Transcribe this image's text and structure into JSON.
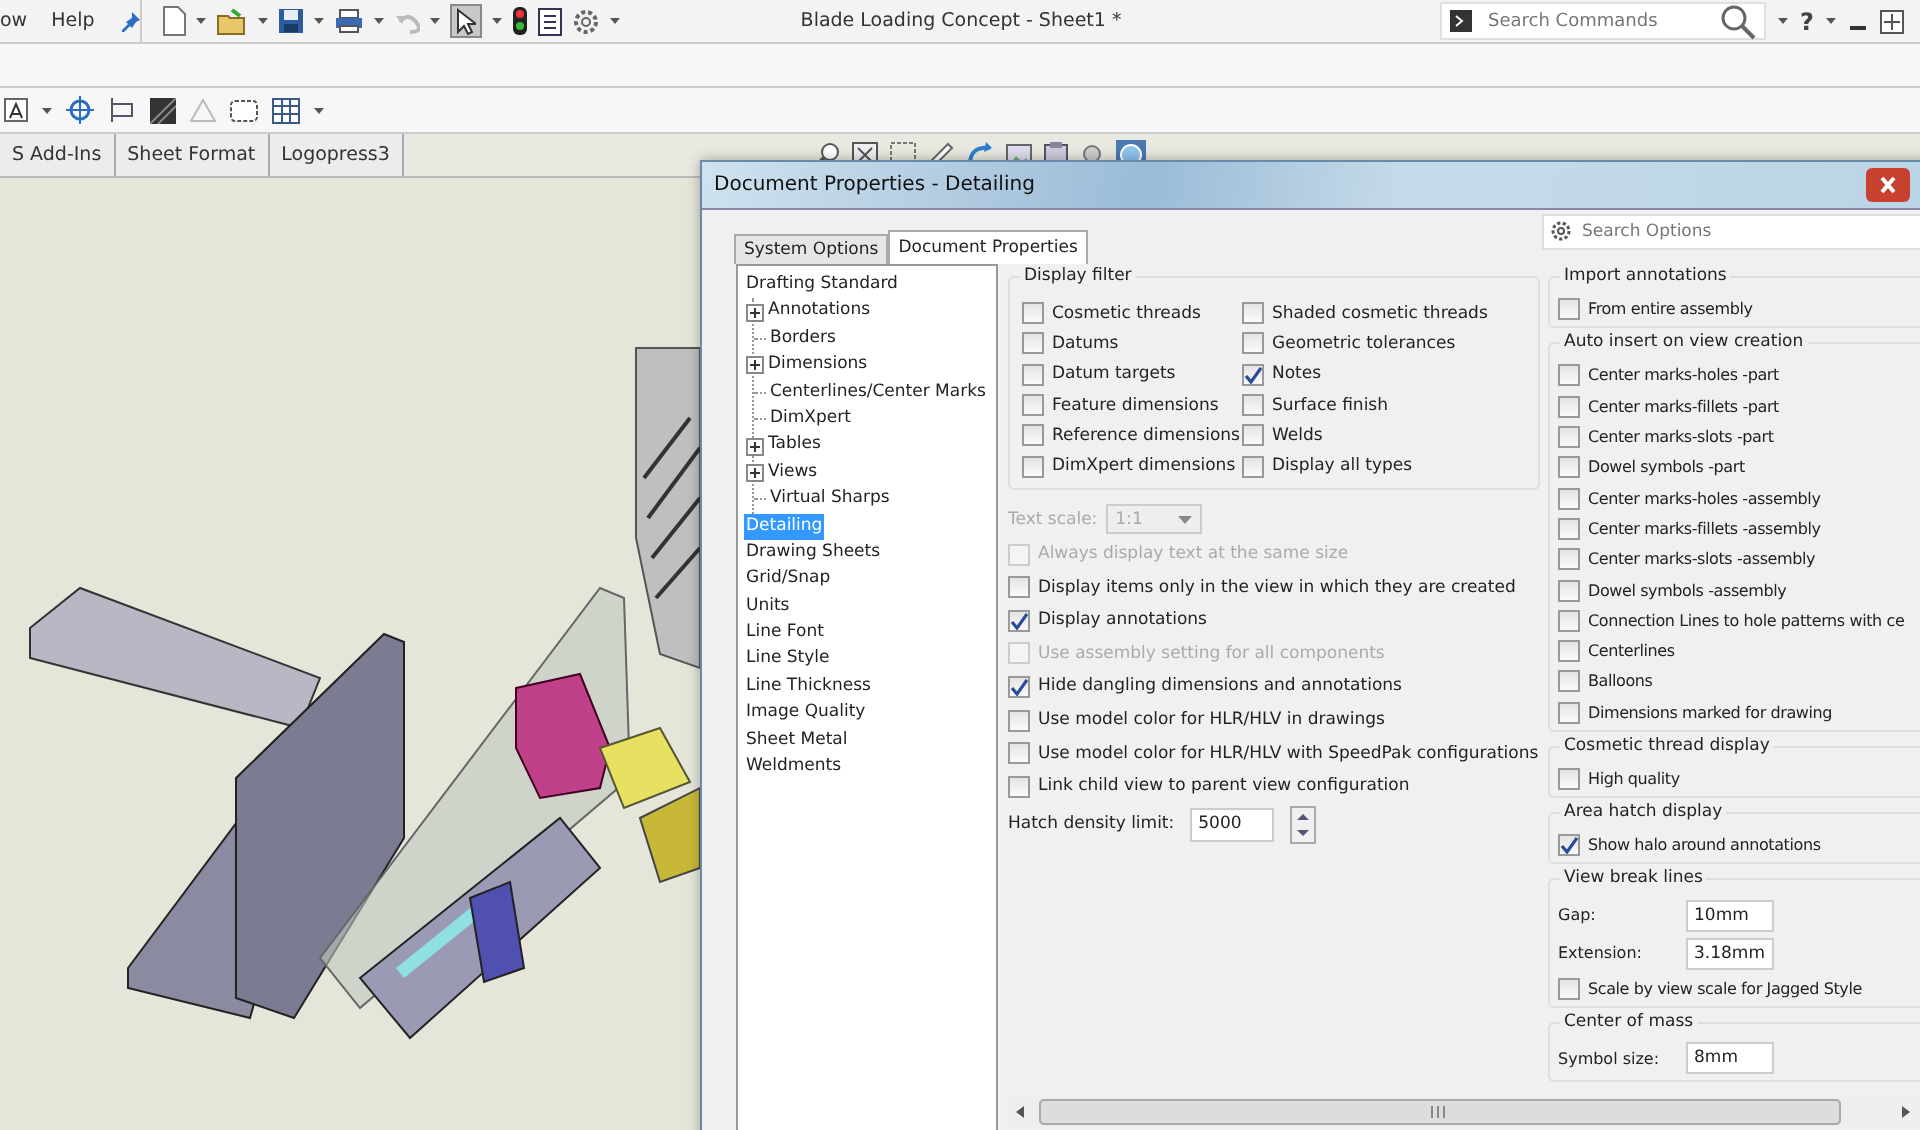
{
  "menu": [
    {
      "label": "ow"
    },
    {
      "label": "Help"
    }
  ],
  "window": {
    "title": "Blade Loading Concept - Sheet1 *"
  },
  "search_commands": {
    "placeholder": "Search Commands"
  },
  "help_button": {
    "label": "?"
  },
  "tabs": [
    {
      "label": "S Add-Ins",
      "selected": false
    },
    {
      "label": "Sheet Format",
      "selected": false
    },
    {
      "label": "Logopress3",
      "selected": false
    }
  ],
  "dialog": {
    "title": "Document Properties - Detailing",
    "tabs": [
      {
        "label": "System Options",
        "selected": false
      },
      {
        "label": "Document Properties",
        "selected": true
      }
    ],
    "search": {
      "placeholder": "Search Options"
    },
    "tree": [
      {
        "label": "Drafting Standard",
        "selected": false,
        "children": [
          {
            "label": "Annotations",
            "expandable": true,
            "selected": false
          },
          {
            "label": "Borders",
            "expandable": false,
            "selected": false
          },
          {
            "label": "Dimensions",
            "expandable": true,
            "selected": false
          },
          {
            "label": "Centerlines/Center Marks",
            "expandable": false,
            "selected": false
          },
          {
            "label": "DimXpert",
            "expandable": false,
            "selected": false
          },
          {
            "label": "Tables",
            "expandable": true,
            "selected": false
          },
          {
            "label": "Views",
            "expandable": true,
            "selected": false
          },
          {
            "label": "Virtual Sharps",
            "expandable": false,
            "selected": false
          }
        ]
      },
      {
        "label": "Detailing",
        "selected": true
      },
      {
        "label": "Drawing Sheets",
        "selected": false
      },
      {
        "label": "Grid/Snap",
        "selected": false
      },
      {
        "label": "Units",
        "selected": false
      },
      {
        "label": "Line Font",
        "selected": false
      },
      {
        "label": "Line Style",
        "selected": false
      },
      {
        "label": "Line Thickness",
        "selected": false
      },
      {
        "label": "Image Quality",
        "selected": false
      },
      {
        "label": "Sheet Metal",
        "selected": false
      },
      {
        "label": "Weldments",
        "selected": false
      }
    ],
    "display_filter": {
      "title": "Display filter",
      "items": [
        {
          "label": "Cosmetic threads",
          "checked": false
        },
        {
          "label": "Shaded cosmetic threads",
          "checked": false
        },
        {
          "label": "Datums",
          "checked": false
        },
        {
          "label": "Geometric tolerances",
          "checked": false
        },
        {
          "label": "Datum targets",
          "checked": false
        },
        {
          "label": "Notes",
          "checked": true
        },
        {
          "label": "Feature dimensions",
          "checked": false
        },
        {
          "label": "Surface finish",
          "checked": false
        },
        {
          "label": "Reference dimensions",
          "checked": false
        },
        {
          "label": "Welds",
          "checked": false
        },
        {
          "label": "DimXpert dimensions",
          "checked": false
        },
        {
          "label": "Display all types",
          "checked": false
        }
      ]
    },
    "text_scale": {
      "label": "Text scale:",
      "value": "1:1",
      "disabled": true
    },
    "options": [
      {
        "label": "Always display text at the same size",
        "checked": false,
        "disabled": true
      },
      {
        "label": "Display items only in the view in which they are created",
        "checked": false,
        "disabled": false
      },
      {
        "label": "Display annotations",
        "checked": true,
        "disabled": false
      },
      {
        "label": "Use assembly setting for all components",
        "checked": false,
        "disabled": true
      },
      {
        "label": "Hide dangling dimensions and annotations",
        "checked": true,
        "disabled": false
      },
      {
        "label": "Use model color for HLR/HLV in drawings",
        "checked": false,
        "disabled": false
      },
      {
        "label": "Use model color for HLR/HLV with SpeedPak configurations",
        "checked": false,
        "disabled": false
      },
      {
        "label": "Link child view to parent view configuration",
        "checked": false,
        "disabled": false
      }
    ],
    "hatch_density": {
      "label": "Hatch density limit:",
      "value": "5000"
    },
    "groups": [
      {
        "title": "Import annotations",
        "items": [
          {
            "kind": "checkbox",
            "label": "From entire assembly",
            "checked": false
          }
        ]
      },
      {
        "title": "Auto insert on view creation",
        "items": [
          {
            "kind": "checkbox",
            "label": "Center marks-holes -part",
            "checked": false
          },
          {
            "kind": "checkbox",
            "label": "Center marks-fillets -part",
            "checked": false
          },
          {
            "kind": "checkbox",
            "label": "Center marks-slots  -part",
            "checked": false
          },
          {
            "kind": "checkbox",
            "label": "Dowel symbols -part",
            "checked": false
          },
          {
            "kind": "checkbox",
            "label": "Center marks-holes -assembly",
            "checked": false
          },
          {
            "kind": "checkbox",
            "label": "Center marks-fillets -assembly",
            "checked": false
          },
          {
            "kind": "checkbox",
            "label": "Center marks-slots  -assembly",
            "checked": false
          },
          {
            "kind": "checkbox",
            "label": "Dowel symbols -assembly",
            "checked": false
          },
          {
            "kind": "checkbox",
            "label": "Connection Lines to hole patterns with ce",
            "checked": false
          },
          {
            "kind": "checkbox",
            "label": "Centerlines",
            "checked": false
          },
          {
            "kind": "checkbox",
            "label": "Balloons",
            "checked": false
          },
          {
            "kind": "checkbox",
            "label": "Dimensions marked for drawing",
            "checked": false
          }
        ]
      },
      {
        "title": "Cosmetic thread display",
        "items": [
          {
            "kind": "checkbox",
            "label": "High quality",
            "checked": false
          }
        ]
      },
      {
        "title": "Area hatch display",
        "items": [
          {
            "kind": "checkbox",
            "label": "Show halo around annotations",
            "checked": true
          }
        ]
      },
      {
        "title": "View break lines",
        "items": [
          {
            "kind": "field",
            "label": "Gap:",
            "value": "10mm"
          },
          {
            "kind": "field",
            "label": "Extension:",
            "value": "3.18mm"
          },
          {
            "kind": "checkbox",
            "label": "Scale by view scale for Jagged Style",
            "checked": false
          }
        ]
      },
      {
        "title": "Center of mass",
        "items": [
          {
            "kind": "field",
            "label": "Symbol size:",
            "value": "8mm"
          }
        ]
      }
    ]
  }
}
